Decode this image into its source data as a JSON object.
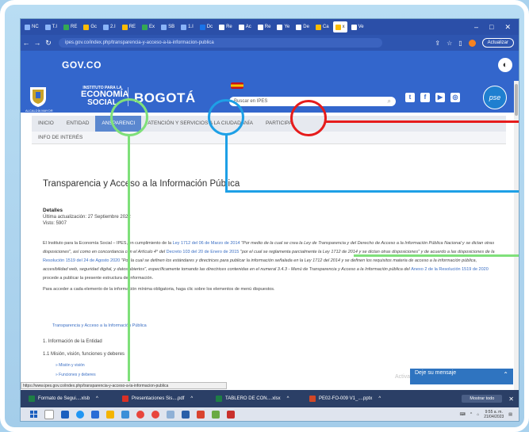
{
  "browser": {
    "tabs": [
      {
        "label": "NC",
        "color": "#8ab4f8"
      },
      {
        "label": "T.I",
        "color": "#8ab4f8"
      },
      {
        "label": "RE",
        "color": "#34a853"
      },
      {
        "label": "Gc",
        "color": "#fbbc04"
      },
      {
        "label": "2.I",
        "color": "#8ab4f8"
      },
      {
        "label": "RE",
        "color": "#fbbc04"
      },
      {
        "label": "Ex",
        "color": "#34a853"
      },
      {
        "label": "SB",
        "color": "#8ab4f8"
      },
      {
        "label": "1.I",
        "color": "#8ab4f8"
      },
      {
        "label": "Dc",
        "color": "#1a73e8"
      },
      {
        "label": "Re",
        "color": "#fff"
      },
      {
        "label": "Ac",
        "color": "#fff"
      },
      {
        "label": "Re",
        "color": "#fff"
      },
      {
        "label": "Ye",
        "color": "#fff"
      },
      {
        "label": "De",
        "color": "#fff"
      },
      {
        "label": "Ca",
        "color": "#fbbc04"
      },
      {
        "label": "x",
        "color": "#fbbc04"
      },
      {
        "label": "Ve",
        "color": "#fff"
      }
    ],
    "url": "ipes.gov.co/index.php/transparencia-y-acceso-a-la-informacion-publica",
    "update_label": "Actualizar"
  },
  "gov": {
    "logo": "GOV.CO"
  },
  "header": {
    "inst_line1": "INSTITUTO PARA LA",
    "inst_line2": "ECONOMÍA",
    "inst_line3": "SOCIAL",
    "brand": "BOGOTÁ",
    "escudo_label": "ALCALDÍA MAYOR DE BOGOTÁ D.C.",
    "search_placeholder": "Buscar en IPES",
    "pse": "pse"
  },
  "nav": {
    "items": [
      "INICIO",
      "ENTIDAD",
      "ANSPARENCI",
      "ATENCIÓN Y SERVICIOS A LA CIUDADANÍA",
      "PARTICIPA"
    ],
    "sub": "INFO DE INTERÉS"
  },
  "content": {
    "title": "Transparencia y Acceso a la Información Pública",
    "details_label": "Detalles",
    "updated": "Última actualización: 27 Septiembre 2022",
    "visits": "Visto: 5907",
    "p1_a": "El Instituto para la Economía Social – IPES, en cumplimiento de la ",
    "p1_link1": "Ley 1712 del 06 de Marzo de 2014",
    "p1_b": " \"Por medio de la cual se crea la Ley de Transparencia y del Derecho de Acceso a la Información Pública Nacional y se dictan otras disposiciones\", así como en concordancia con el Artículo 4° del ",
    "p1_link2": "Decreto 103 del 20 de Enero de 2015",
    "p1_c": " \"por el cual se reglamenta parcialmente la Ley 1712 de 2014 y se dictan otras disposiciones\" y de acuerdo a las disposiciones de la ",
    "p1_link3": "Resolución 1519 del 24 de Agosto 2020",
    "p1_d": " \"Por la cual se definen los estándares y directrices para publicar la información señalada en la Ley 1712 del 2014 y se definen los requisitos materia de acceso a la información pública, accesibilidad web, seguridad digital, y datos abiertos\", específicamente tomando las directrices contenidas en el numeral 3.4.3 - Menú de Transparencia y Acceso a la Información pública del ",
    "p1_link4": "Anexo 2 de la Resolución 1519 de 2020",
    "p1_e": " procede a publicar la presente estructura de información.",
    "p2": "Para acceder a cada elemento de la información mínima obligatoria, haga clic sobre los elementos de menú dispuestos.",
    "toc_title": "Transparencia y Acceso a la Información Pública",
    "toc_1": "1. Información de la Entidad",
    "toc_1_1": "1.1 Misión, visión, funciones y deberes",
    "toc_sub1": "» Misión y visión",
    "toc_sub2": "» Funciones y deberes"
  },
  "status_url": "https://www.ipes.gov.co/index.php/transparencia-y-acceso-a-la-informacion-publica",
  "chat": {
    "label": "Deje su mensaje",
    "watermark": "Activar Windows"
  },
  "downloads": [
    {
      "name": "Formato de Segui....xlsb",
      "color": "#1e7e45"
    },
    {
      "name": "Presentaciones Sis....pdf",
      "color": "#d93025"
    },
    {
      "name": "TABLERO DE CON....xlsx",
      "color": "#1e7e45"
    },
    {
      "name": "PE02-FO-009 V1_....pptx",
      "color": "#d24726"
    }
  ],
  "downloads_show_all": "Mostrar todo",
  "taskbar": {
    "time": "9:55 a. m.",
    "date": "21/04/2023"
  },
  "annotations": {
    "green": "#7fe07a",
    "blue": "#1ea0e6",
    "red": "#e61c1c"
  }
}
